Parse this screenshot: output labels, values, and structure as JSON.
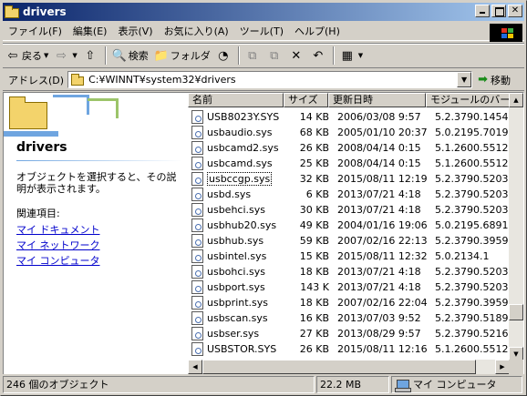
{
  "window": {
    "title": "drivers"
  },
  "menu": [
    "ファイル(F)",
    "編集(E)",
    "表示(V)",
    "お気に入り(A)",
    "ツール(T)",
    "ヘルプ(H)"
  ],
  "toolbar": {
    "back_label": "戻る",
    "search_label": "検索",
    "folders_label": "フォルダ"
  },
  "address": {
    "label": "アドレス(D)",
    "path": "C:¥WINNT¥system32¥drivers",
    "go_label": "移動"
  },
  "left_panel": {
    "title": "drivers",
    "description": "オブジェクトを選択すると、その説明が表示されます。",
    "related_label": "関連項目:",
    "links": [
      "マイ ドキュメント",
      "マイ ネットワーク",
      "マイ コンピュータ"
    ]
  },
  "columns": [
    "名前",
    "サイズ",
    "更新日時",
    "モジュールのバージョン"
  ],
  "files": [
    {
      "name": "USB8023Y.SYS",
      "size": "14 KB",
      "date": "2006/03/08 9:57",
      "version": "5.2.3790.1454"
    },
    {
      "name": "usbaudio.sys",
      "size": "68 KB",
      "date": "2005/01/10 20:37",
      "version": "5.0.2195.7019"
    },
    {
      "name": "usbcamd2.sys",
      "size": "26 KB",
      "date": "2008/04/14 0:15",
      "version": "5.1.2600.5512"
    },
    {
      "name": "usbcamd.sys",
      "size": "25 KB",
      "date": "2008/04/14 0:15",
      "version": "5.1.2600.5512"
    },
    {
      "name": "usbccgp.sys",
      "size": "32 KB",
      "date": "2015/08/11 12:19",
      "version": "5.2.3790.5203"
    },
    {
      "name": "usbd.sys",
      "size": "6 KB",
      "date": "2013/07/21 4:18",
      "version": "5.2.3790.5203"
    },
    {
      "name": "usbehci.sys",
      "size": "30 KB",
      "date": "2013/07/21 4:18",
      "version": "5.2.3790.5203"
    },
    {
      "name": "usbhub20.sys",
      "size": "49 KB",
      "date": "2004/01/16 19:06",
      "version": "5.0.2195.6891"
    },
    {
      "name": "usbhub.sys",
      "size": "59 KB",
      "date": "2007/02/16 22:13",
      "version": "5.2.3790.3959"
    },
    {
      "name": "usbintel.sys",
      "size": "15 KB",
      "date": "2015/08/11 12:32",
      "version": "5.0.2134.1"
    },
    {
      "name": "usbohci.sys",
      "size": "18 KB",
      "date": "2013/07/21 4:18",
      "version": "5.2.3790.5203"
    },
    {
      "name": "usbport.sys",
      "size": "143 K",
      "date": "2013/07/21 4:18",
      "version": "5.2.3790.5203"
    },
    {
      "name": "usbprint.sys",
      "size": "18 KB",
      "date": "2007/02/16 22:04",
      "version": "5.2.3790.3959"
    },
    {
      "name": "usbscan.sys",
      "size": "16 KB",
      "date": "2013/07/03 9:52",
      "version": "5.2.3790.5189"
    },
    {
      "name": "usbser.sys",
      "size": "27 KB",
      "date": "2013/08/29 9:57",
      "version": "5.2.3790.5216"
    },
    {
      "name": "USBSTOR.SYS",
      "size": "26 KB",
      "date": "2015/08/11 12:16",
      "version": "5.1.2600.5512"
    }
  ],
  "focused_file_index": 4,
  "status": {
    "objects": "246 個のオブジェクト",
    "size": "22.2 MB",
    "zone": "マイ コンピュータ"
  }
}
